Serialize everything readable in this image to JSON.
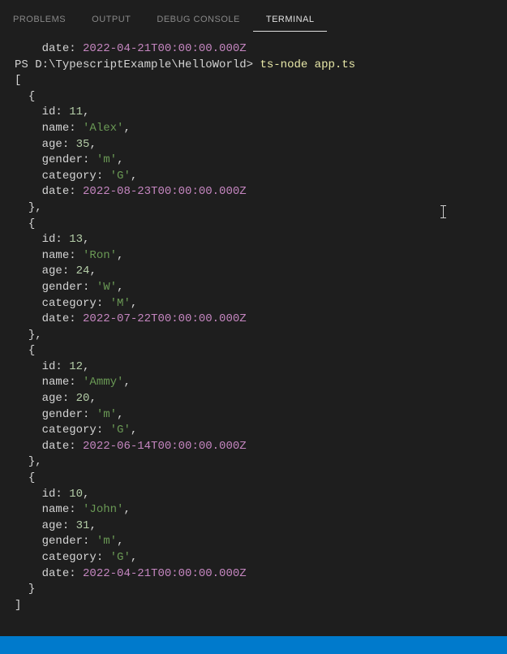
{
  "tabs": [
    {
      "label": "PROBLEMS",
      "active": false
    },
    {
      "label": "OUTPUT",
      "active": false
    },
    {
      "label": "DEBUG CONSOLE",
      "active": false
    },
    {
      "label": "TERMINAL",
      "active": true
    }
  ],
  "firstLine": {
    "key": "date",
    "value": "2022-04-21T00:00:00.000Z"
  },
  "promptLine": {
    "prefix": "PS ",
    "path": "D:\\TypescriptExample\\HelloWorld>",
    "command": "ts-node app.ts"
  },
  "output": [
    {
      "id": 11,
      "name": "Alex",
      "age": 35,
      "gender": "m",
      "category": "G",
      "date": "2022-08-23T00:00:00.000Z"
    },
    {
      "id": 13,
      "name": "Ron",
      "age": 24,
      "gender": "W",
      "category": "M",
      "date": "2022-07-22T00:00:00.000Z"
    },
    {
      "id": 12,
      "name": "Ammy",
      "age": 20,
      "gender": "m",
      "category": "G",
      "date": "2022-06-14T00:00:00.000Z"
    },
    {
      "id": 10,
      "name": "John",
      "age": 31,
      "gender": "m",
      "category": "G",
      "date": "2022-04-21T00:00:00.000Z"
    }
  ],
  "keys": {
    "id": "id",
    "name": "name",
    "age": "age",
    "gender": "gender",
    "category": "category",
    "date": "date"
  }
}
